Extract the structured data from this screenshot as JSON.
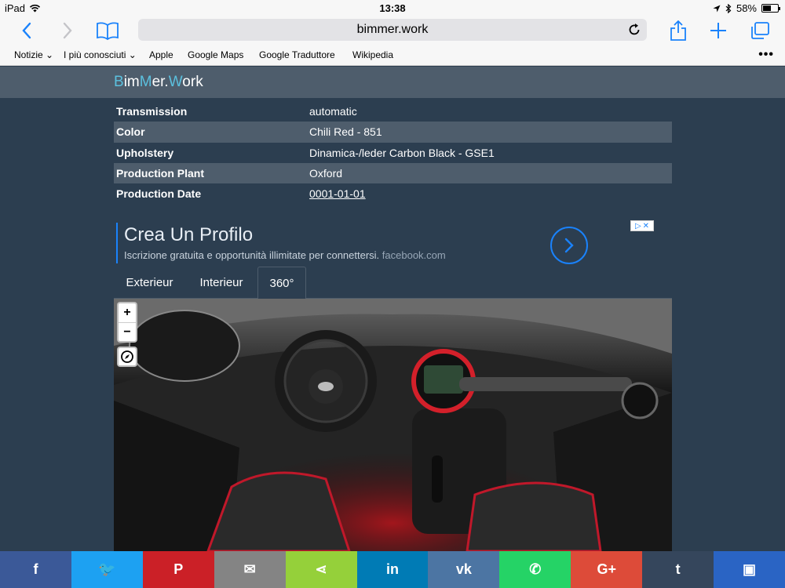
{
  "status_bar": {
    "device": "iPad",
    "time": "13:38",
    "battery": "58%",
    "battery_level": 0.58
  },
  "browser": {
    "url": "bimmer.work",
    "bookmarks": [
      "Notizie",
      "I più conosciuti",
      "Apple",
      "Google Maps",
      "Google Traduttore",
      "Wikipedia"
    ],
    "more_label": "•••"
  },
  "site": {
    "logo": {
      "b1": "B",
      "p1": "im",
      "b2": "M",
      "p2": "er.",
      "b3": "W",
      "p3": "ork"
    }
  },
  "specs": [
    {
      "key": "Transmission",
      "value": "automatic"
    },
    {
      "key": "Color",
      "value": "Chili Red - 851"
    },
    {
      "key": "Upholstery",
      "value": "Dinamica-/leder Carbon Black - GSE1"
    },
    {
      "key": "Production Plant",
      "value": "Oxford"
    },
    {
      "key": "Production Date",
      "value": "0001-01-01"
    }
  ],
  "ad": {
    "title": "Crea Un Profilo",
    "subtitle": "Iscrizione gratuita e opportunità illimitate per connettersi.",
    "domain": "facebook.com"
  },
  "tabs": [
    {
      "label": "Exterieur",
      "active": false
    },
    {
      "label": "Interieur",
      "active": false
    },
    {
      "label": "360°",
      "active": true
    }
  ],
  "viewer": {
    "zoom_in": "+",
    "zoom_out": "−"
  },
  "share": [
    {
      "icon": "facebook-icon",
      "glyph": "f",
      "color": "#3b5998"
    },
    {
      "icon": "twitter-icon",
      "glyph": "🐦",
      "color": "#1da1f2"
    },
    {
      "icon": "pinterest-icon",
      "glyph": "P",
      "color": "#cb2027"
    },
    {
      "icon": "email-icon",
      "glyph": "✉",
      "color": "#848484"
    },
    {
      "icon": "share-icon",
      "glyph": "⋖",
      "color": "#95d03a"
    },
    {
      "icon": "linkedin-icon",
      "glyph": "in",
      "color": "#007bb5"
    },
    {
      "icon": "vk-icon",
      "glyph": "vk",
      "color": "#4c75a3"
    },
    {
      "icon": "whatsapp-icon",
      "glyph": "✆",
      "color": "#25d366"
    },
    {
      "icon": "googleplus-icon",
      "glyph": "G+",
      "color": "#dd4b39"
    },
    {
      "icon": "tumblr-icon",
      "glyph": "t",
      "color": "#35465c"
    },
    {
      "icon": "more-share-icon",
      "glyph": "▣",
      "color": "#2a64c4"
    }
  ]
}
